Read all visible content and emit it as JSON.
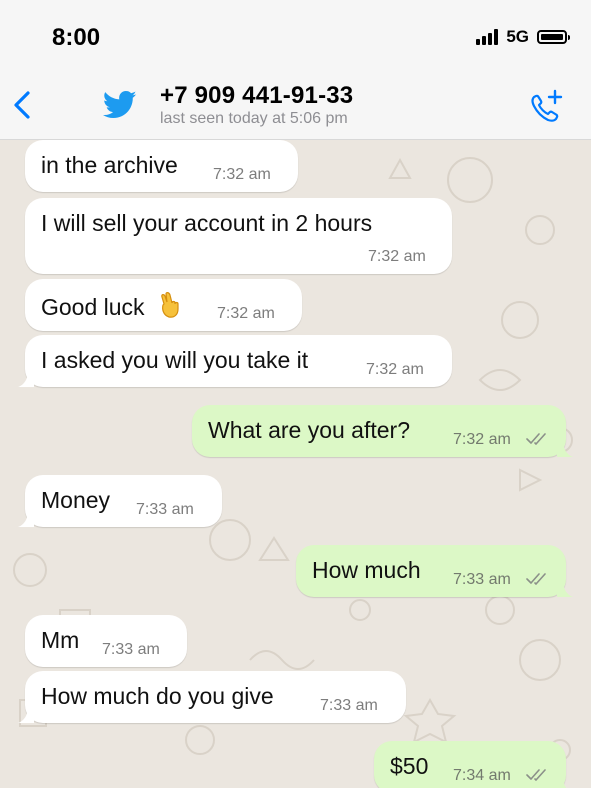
{
  "status_bar": {
    "time": "8:00",
    "network": "5G"
  },
  "header": {
    "contact_name": "+7 909 441-91-33",
    "last_seen": "last seen today at 5:06 pm",
    "back_icon": "chevron-left-icon",
    "avatar_icon": "twitter-bird-icon",
    "call_icon": "add-call-icon"
  },
  "colors": {
    "accent": "#007aff",
    "incoming_bubble": "#ffffff",
    "outgoing_bubble": "#dcf8c6",
    "chat_background": "#ebe6df",
    "read_ticks": "#8b9089"
  },
  "messages": [
    {
      "direction": "incoming",
      "text": "in the archive",
      "time": "7:32 am"
    },
    {
      "direction": "incoming",
      "text": "I will sell your account in 2 hours",
      "time": "7:32 am"
    },
    {
      "direction": "incoming",
      "text": "Good luck",
      "emoji": "crossed-fingers-emoji",
      "time": "7:32 am"
    },
    {
      "direction": "incoming",
      "text": "I asked you will you take it",
      "time": "7:32 am"
    },
    {
      "direction": "outgoing",
      "text": "What are you after?",
      "time": "7:32 am",
      "status": "read"
    },
    {
      "direction": "incoming",
      "text": "Money",
      "time": "7:33 am"
    },
    {
      "direction": "outgoing",
      "text": "How much",
      "time": "7:33 am",
      "status": "read"
    },
    {
      "direction": "incoming",
      "text": "Mm",
      "time": "7:33 am"
    },
    {
      "direction": "incoming",
      "text": "How much do you give",
      "time": "7:33 am"
    },
    {
      "direction": "outgoing",
      "text": "$50",
      "time": "7:34 am",
      "status": "read"
    }
  ]
}
